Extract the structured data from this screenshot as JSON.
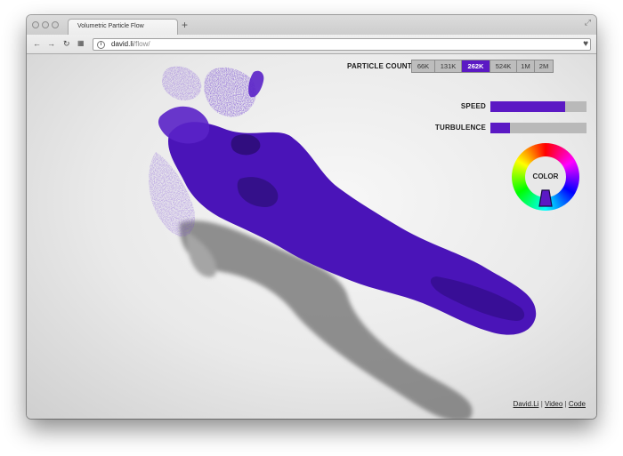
{
  "browser": {
    "tab_title": "Volumetric Particle Flow",
    "new_tab": "+",
    "url_host": "david.li",
    "url_path": "/flow/"
  },
  "controls": {
    "particle_count_label": "PARTICLE COUNT",
    "particle_counts": [
      "66K",
      "131K",
      "262K",
      "524K",
      "1M",
      "2M"
    ],
    "particle_count_selected": "262K",
    "speed_label": "SPEED",
    "speed_value": 0.78,
    "turbulence_label": "TURBULENCE",
    "turbulence_value": 0.2,
    "color_label": "COLOR",
    "selected_color": "#5b19c4"
  },
  "footer": {
    "link_author": "David.Li",
    "link_video": "Video",
    "link_code": "Code",
    "separator": "|"
  },
  "colors": {
    "accent": "#5b19c4",
    "particle": "#4a14b8",
    "particle_light": "#7a4ad6",
    "shadow": "#7a7a7a"
  }
}
